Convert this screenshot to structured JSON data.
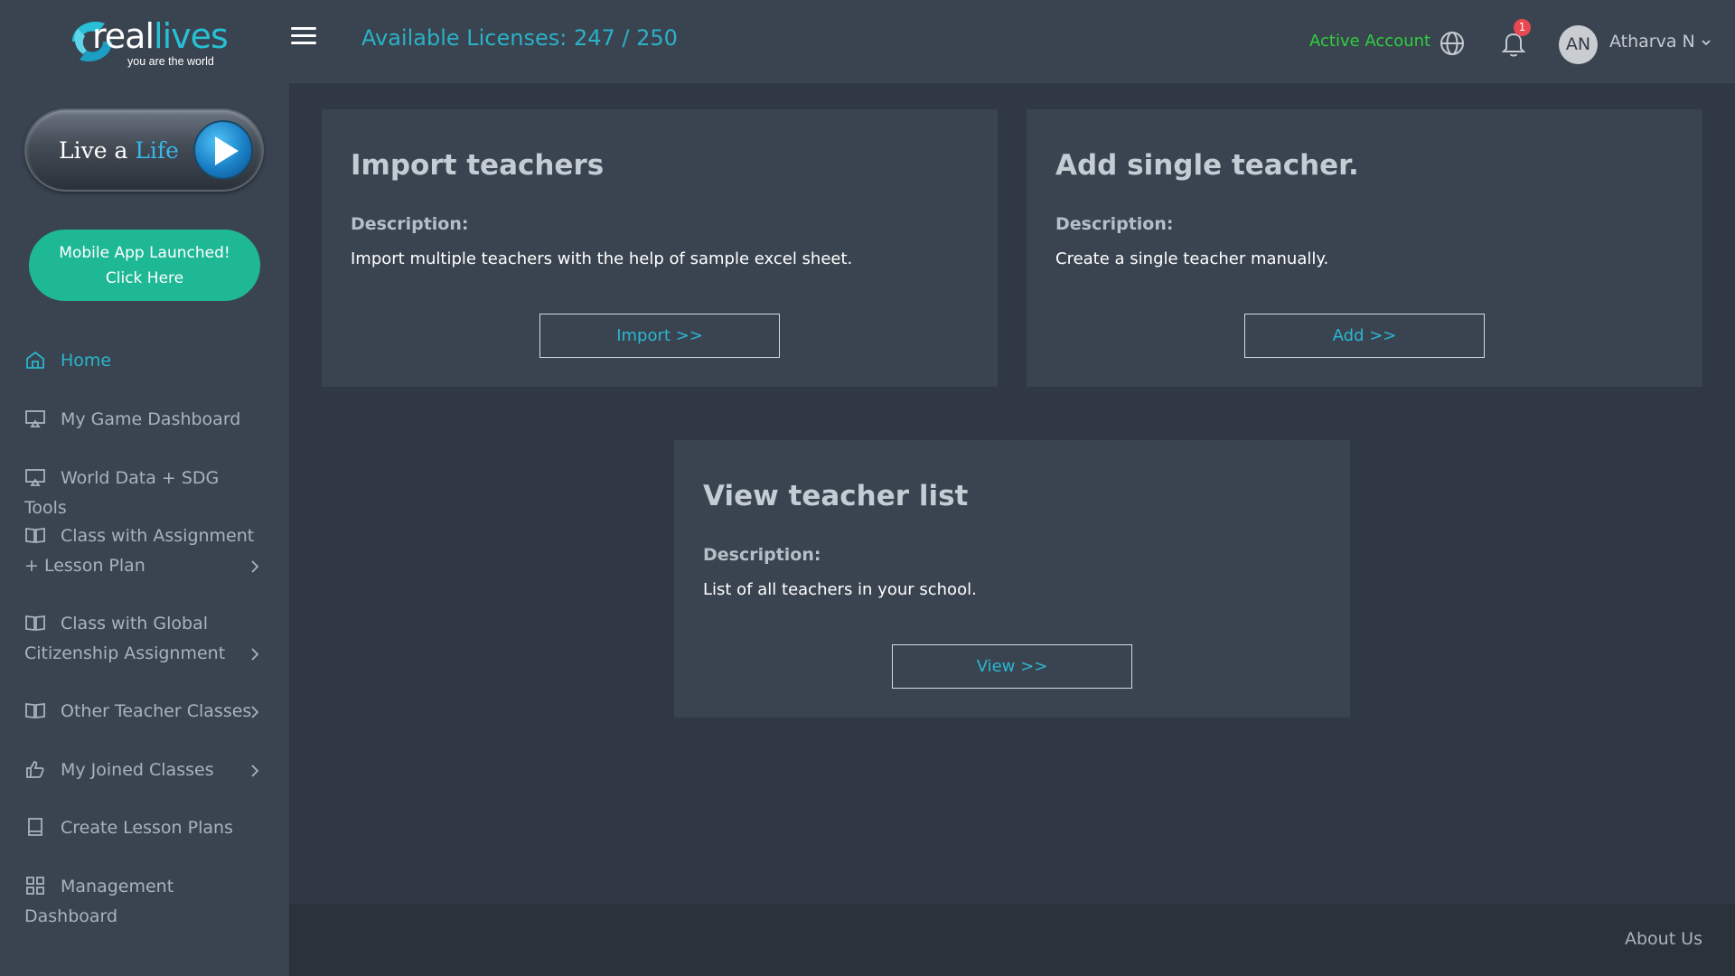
{
  "brand": {
    "name_part1": "real",
    "name_part2": "lives",
    "tagline": "you are the world"
  },
  "sidebar": {
    "live_life": {
      "part1": "Live a ",
      "part2": "Life"
    },
    "mobile_app": {
      "line1": "Mobile App Launched!",
      "line2": "Click Here"
    },
    "items": [
      {
        "label": "Home",
        "icon": "home-icon",
        "active": true
      },
      {
        "label": "My Game Dashboard",
        "icon": "monitor-icon"
      },
      {
        "label": "World Data + SDG Tools",
        "icon": "monitor-icon"
      },
      {
        "label": "Class with Assignment + Lesson Plan",
        "line1": "Class with Assignment",
        "line2": "+ Lesson Plan",
        "icon": "book-open-icon",
        "has_submenu": true
      },
      {
        "label": "Class with Global Citizenship Assignment",
        "line1": "Class with Global",
        "line2": "Citizenship Assignment",
        "icon": "book-open-icon",
        "has_submenu": true
      },
      {
        "label": "Other Teacher Classes",
        "icon": "book-open-icon",
        "has_submenu": true
      },
      {
        "label": "My Joined Classes",
        "icon": "thumbs-up-icon",
        "has_submenu": true
      },
      {
        "label": "Create Lesson Plans",
        "icon": "book-icon"
      },
      {
        "label": "Management Dashboard",
        "line1": "Management",
        "line2": "Dashboard",
        "icon": "grid-icon"
      }
    ]
  },
  "header": {
    "licenses": "Available Licenses: 247 / 250",
    "account_status": "Active Account",
    "notification_count": "1",
    "avatar_initials": "AN",
    "user_name": "Atharva N"
  },
  "cards": [
    {
      "title": "Import teachers",
      "desc_label": "Description:",
      "desc": "Import multiple teachers with the help of sample excel sheet.",
      "button": "Import >>"
    },
    {
      "title": "Add single teacher.",
      "desc_label": "Description:",
      "desc": "Create a single teacher manually.",
      "button": "Add >>"
    },
    {
      "title": "View teacher list",
      "desc_label": "Description:",
      "desc": "List of all teachers in your school.",
      "button": "View >>"
    }
  ],
  "footer": {
    "about": "About Us"
  },
  "colors": {
    "accent": "#2ab1c7",
    "active_account": "#2fcf3a",
    "mobile_button": "#1fb895",
    "badge": "#e8484f",
    "background": "#2f3843",
    "panel": "#3a4450"
  }
}
